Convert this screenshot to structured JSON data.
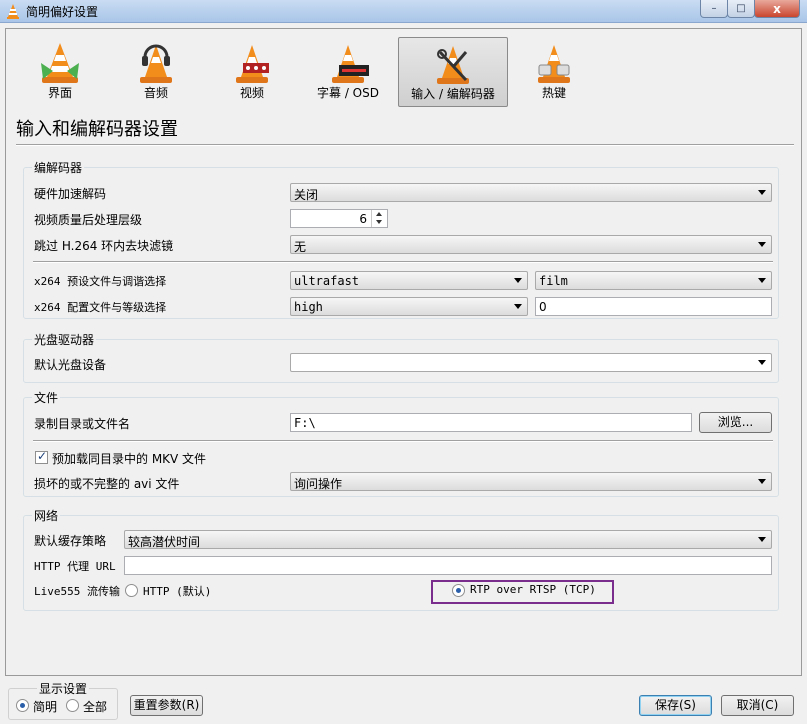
{
  "window": {
    "title": "简明偏好设置",
    "close": "x",
    "minimize": "–",
    "maximize": "□"
  },
  "tabs": [
    {
      "label": "界面"
    },
    {
      "label": "音频"
    },
    {
      "label": "视频"
    },
    {
      "label": "字幕 / OSD"
    },
    {
      "label": "输入 / 编解码器"
    },
    {
      "label": "热键"
    }
  ],
  "page": {
    "title": "输入和编解码器设置"
  },
  "codecs": {
    "group": "编解码器",
    "hw_label": "硬件加速解码",
    "hw_value": "关闭",
    "pp_label": "视频质量后处理层级",
    "pp_value": "6",
    "skip_label": "跳过 H.264 环内去块滤镜",
    "skip_value": "无",
    "preset_label": "x264 预设文件与调谐选择",
    "preset_value": "ultrafast",
    "tune_value": "film",
    "profile_label": "x264 配置文件与等级选择",
    "profile_value": "high",
    "level_value": "0"
  },
  "disc": {
    "group": "光盘驱动器",
    "device_label": "默认光盘设备",
    "device_value": ""
  },
  "files": {
    "group": "文件",
    "record_label": "录制目录或文件名",
    "record_value": "F:\\",
    "browse": "浏览...",
    "mkv_label": "预加载同目录中的 MKV 文件",
    "avi_label": "损坏的或不完整的 avi 文件",
    "avi_value": "询问操作"
  },
  "network": {
    "group": "网络",
    "cache_label": "默认缓存策略",
    "cache_value": "较高潜伏时间",
    "proxy_label": "HTTP 代理 URL",
    "proxy_value": "",
    "live_label": "Live555 流传输",
    "http_option": "HTTP (默认)",
    "rtsp_option": "RTP over RTSP (TCP)"
  },
  "footer": {
    "show_group": "显示设置",
    "simple": "简明",
    "all": "全部",
    "reset": "重置参数(R)",
    "save": "保存(S)",
    "cancel": "取消(C)"
  },
  "colors": {
    "highlight": "#7b2d8e",
    "cone": "#f28c1b"
  }
}
